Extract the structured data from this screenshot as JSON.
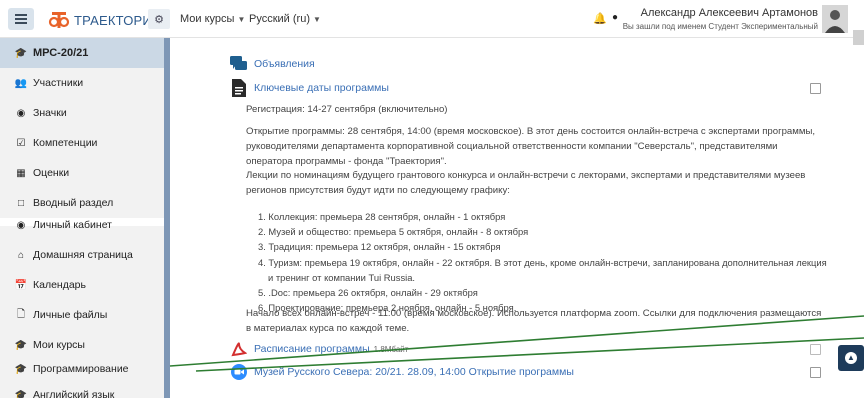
{
  "header": {
    "logo_text": "ТРАЕКТОРИЯ",
    "nav_my_courses": "Мои курсы",
    "nav_language": "Русский (ru)",
    "user_name": "Александр Алексеевич Артамонов",
    "user_sub": "Вы зашли под именем Студент Экспериментальный",
    "icons": [
      "menu-icon",
      "gear-icon",
      "bell-icon",
      "chat-icon"
    ]
  },
  "sidebar": {
    "items": [
      {
        "label": "МРС-20/21",
        "icon": "graduation-cap-icon"
      },
      {
        "label": "Участники",
        "icon": "users-icon"
      },
      {
        "label": "Значки",
        "icon": "shield-icon"
      },
      {
        "label": "Компетенции",
        "icon": "check-square-icon"
      },
      {
        "label": "Оценки",
        "icon": "table-icon"
      },
      {
        "label": "Вводный раздел",
        "icon": "folder-icon"
      },
      {
        "label": "Личный кабинет",
        "icon": "dashboard-icon"
      },
      {
        "label": "Домашняя страница",
        "icon": "home-icon"
      },
      {
        "label": "Календарь",
        "icon": "calendar-icon"
      },
      {
        "label": "Личные файлы",
        "icon": "file-icon"
      },
      {
        "label": "Мои курсы",
        "icon": "graduation-cap-icon"
      },
      {
        "label": "Программирование",
        "icon": "graduation-cap-icon"
      },
      {
        "label": "Английский язык",
        "icon": "graduation-cap-icon"
      }
    ]
  },
  "main": {
    "announcements": "Объявления",
    "key_dates": "Ключевые даты программы",
    "registration": "Регистрация: 14-27 сентября (включительно)",
    "opening": "Открытие программы: 28 сентября, 14:00 (время московское). В этот день состоится онлайн-встреча с экспертами программы, руководителями департамента корпоративной социальной ответственности компании \"Северсталь\", представителями оператора программы - фонда \"Траектория\".",
    "lectures_intro": "Лекции по номинациям будущего грантового конкурса и онлайн-встречи с лекторами, экспертами и представителями музеев регионов присутствия будут идти по следующему графику:",
    "schedule": [
      "1. Коллекция: премьера 28 сентября, онлайн - 1 октября",
      "2. Музей и общество: премьера 5 октября, онлайн - 8 октября",
      "3. Традиция: премьера 12 октября, онлайн - 15 октября",
      "4. Туризм: премьера 19 октября, онлайн - 22 октября. В этот день, кроме онлайн-встречи, запланирована дополнительная лекция",
      "и тренинг от компании Tui Russia.",
      "5. .Doc: премьера 26 октября, онлайн - 29 октября",
      "6. Проектирование: премьера 2 ноября, онлайн - 5 ноября."
    ],
    "meetings_note": "Начало всех онлайн-встреч - 11:00 (время московское). Используется платформа zoom. Ссылки для подключения размещаются в материалах курса по каждой теме.",
    "schedule_file": "Расписание программы",
    "schedule_file_size": "1.8Мбайт",
    "zoom_meeting": "Музей Русского Севера: 20/21. 28.09, 14:00 Открытие программы"
  },
  "colors": {
    "sidebar_bg": "#f2f2f2",
    "sidebar_active": "#cbd8e5",
    "sidebar_border": "#7e97b6",
    "link": "#3a6fb5",
    "logo_orange": "#e8632a",
    "annotation_line": "#2e7d32"
  }
}
